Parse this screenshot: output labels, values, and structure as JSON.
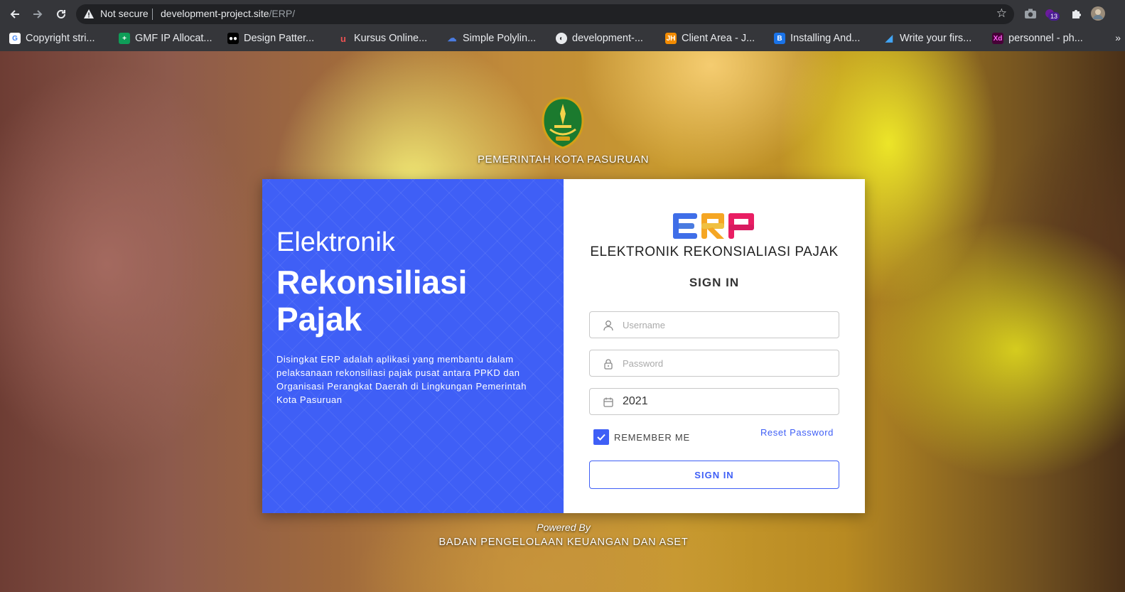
{
  "browser": {
    "security_label": "Not secure",
    "url_host": "development-project.site",
    "url_path": "/ERP/",
    "extension_badge": "13",
    "bookmarks": [
      {
        "label": "Copyright stri...",
        "icon": "google-icon",
        "color": "#4285f4"
      },
      {
        "label": "GMF IP Allocat...",
        "icon": "sheets-icon",
        "color": "#0f9d58"
      },
      {
        "label": "Design Patter...",
        "icon": "medium-icon",
        "color": "#000000"
      },
      {
        "label": "Kursus Online...",
        "icon": "udemy-icon",
        "color": "#ec5252"
      },
      {
        "label": "Simple Polylin...",
        "icon": "cloud-icon",
        "color": "#4a7be0"
      },
      {
        "label": "development-...",
        "icon": "globe-icon",
        "color": "#e8eaed"
      },
      {
        "label": "Client Area - J...",
        "icon": "jh-icon",
        "color": "#f28b00"
      },
      {
        "label": "Installing And...",
        "icon": "doc-icon",
        "color": "#1a73e8"
      },
      {
        "label": "Write your firs...",
        "icon": "flutter-icon",
        "color": "#42a5f5"
      },
      {
        "label": "personnel - ph...",
        "icon": "xd-icon",
        "color": "#470137"
      }
    ],
    "more_label": "»"
  },
  "page": {
    "gov_title": "PEMERINTAH KOTA PASURUAN",
    "left_panel": {
      "line1": "Elektronik",
      "line2": "Rekonsiliasi",
      "line3": "Pajak",
      "description": "Disingkat ERP adalah aplikasi yang membantu dalam pelaksanaan rekonsiliasi pajak pusat antara PPKD dan Organisasi Perangkat Daerah di Lingkungan Pemerintah Kota Pasuruan"
    },
    "logo": {
      "text": "ERP",
      "subtitle": "ELEKTRONIK REKONSIALIASI PAJAK",
      "colors": {
        "e": "#3f6ee8",
        "r": "#f5a623",
        "p": "#e91e63"
      }
    },
    "form": {
      "title": "SIGN IN",
      "username_placeholder": "Username",
      "password_placeholder": "Password",
      "year_value": "2021",
      "remember_label": "REMEMBER ME",
      "remember_checked": true,
      "reset_label": "Reset Password",
      "submit_label": "SIGN IN"
    },
    "footer": {
      "powered_by": "Powered By",
      "org": "BADAN PENGELOLAAN KEUANGAN DAN ASET"
    },
    "accent": "#3f5ff6"
  }
}
